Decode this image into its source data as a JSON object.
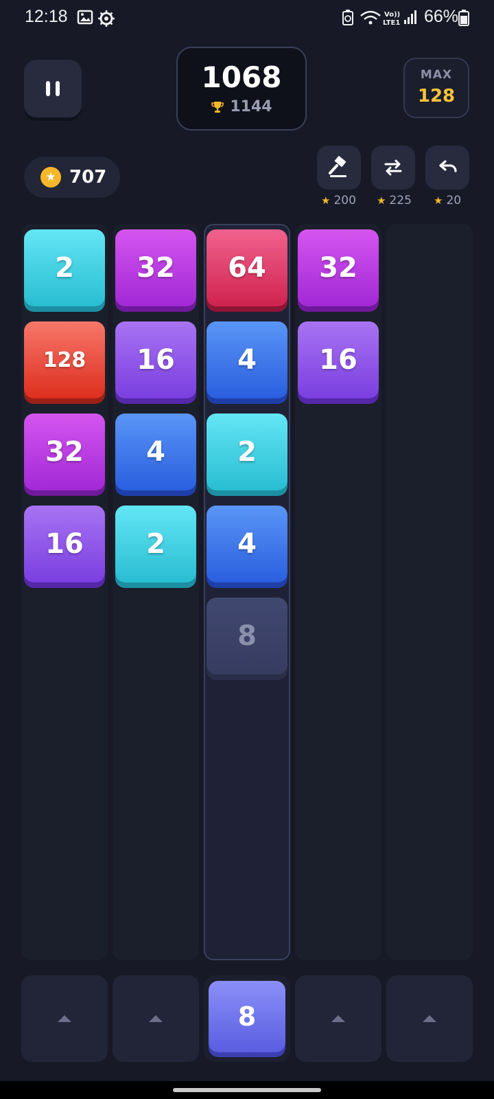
{
  "status_bar": {
    "time": "12:18",
    "battery": "66%"
  },
  "header": {
    "score": "1068",
    "best": "1144",
    "max_label": "MAX",
    "max_value": "128"
  },
  "coins": "707",
  "powerups": [
    {
      "name": "hammer",
      "cost": "200"
    },
    {
      "name": "swap",
      "cost": "225"
    },
    {
      "name": "undo",
      "cost": "20"
    }
  ],
  "board": {
    "columns": [
      {
        "tiles": [
          "2",
          "128",
          "32",
          "16"
        ]
      },
      {
        "tiles": [
          "32",
          "16",
          "4",
          "2"
        ]
      },
      {
        "tiles": [
          "64",
          "4",
          "2",
          "4"
        ],
        "preview": "8",
        "active": true
      },
      {
        "tiles": [
          "32",
          "16"
        ]
      },
      {
        "tiles": []
      }
    ]
  },
  "next_tile": "8",
  "colors": {
    "2": "#38c9dd",
    "4": "#2f6fe6",
    "8": "#5e62e6",
    "16": "#8248e6",
    "32": "#b53ce3",
    "64": "#df2f64",
    "128": "#ee4a36",
    "coin": "#f5b72a",
    "max": "#f8c23a"
  }
}
